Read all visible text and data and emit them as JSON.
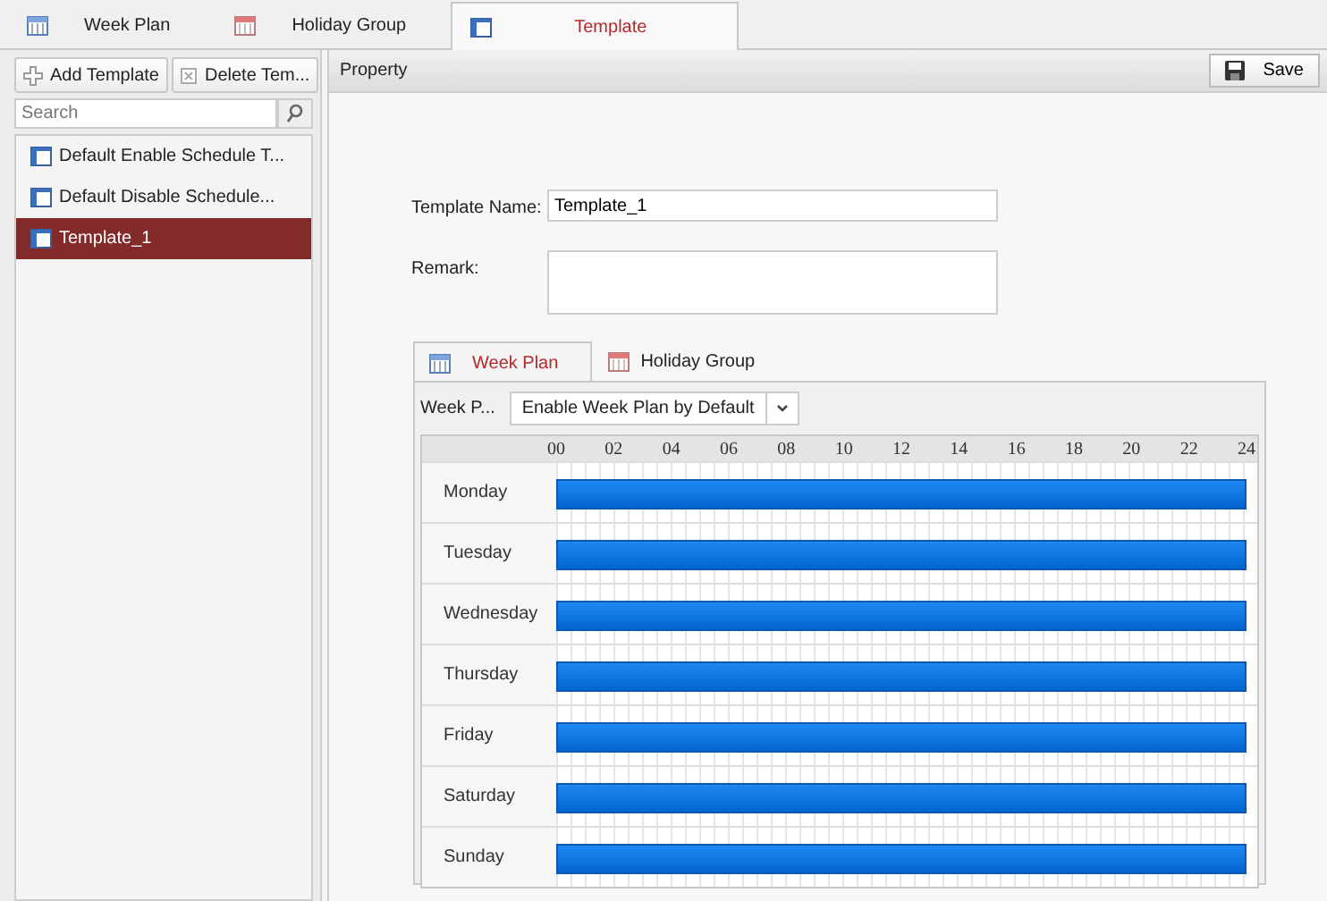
{
  "top_tabs": [
    {
      "label": "Week Plan",
      "selected": false
    },
    {
      "label": "Holiday Group",
      "selected": false
    },
    {
      "label": "Template",
      "selected": true
    }
  ],
  "sidebar": {
    "buttons": [
      {
        "label": "Add Template"
      },
      {
        "label": "Delete Tem..."
      }
    ],
    "search": {
      "placeholder": "Search"
    },
    "items": [
      {
        "label": "Default Enable Schedule T...",
        "selected": false
      },
      {
        "label": "Default Disable Schedule...",
        "selected": false
      },
      {
        "label": "Template_1",
        "selected": true
      }
    ]
  },
  "property": {
    "title": "Property",
    "save_button": "Save",
    "template_name_label": "Template Name:",
    "template_name": "Template_1",
    "remark_label": "Remark:",
    "tabs": [
      {
        "label": "Week Plan",
        "selected": true
      },
      {
        "label": "Holiday Group",
        "selected": false
      }
    ],
    "week_plan_label": "Week P...",
    "week_plan_value": "Enable Week Plan by Default",
    "hours": [
      "00",
      "02",
      "04",
      "06",
      "08",
      "10",
      "12",
      "14",
      "16",
      "18",
      "20",
      "22",
      "24"
    ],
    "days": [
      {
        "name": "Monday",
        "level": 1
      },
      {
        "name": "Tuesday",
        "level": 1
      },
      {
        "name": "Wednesday",
        "level": 1
      },
      {
        "name": "Thursday",
        "level": 1
      },
      {
        "name": "Friday",
        "level": 1
      },
      {
        "name": "Saturday",
        "level": 1
      },
      {
        "name": "Sunday",
        "level": 1
      }
    ]
  }
}
